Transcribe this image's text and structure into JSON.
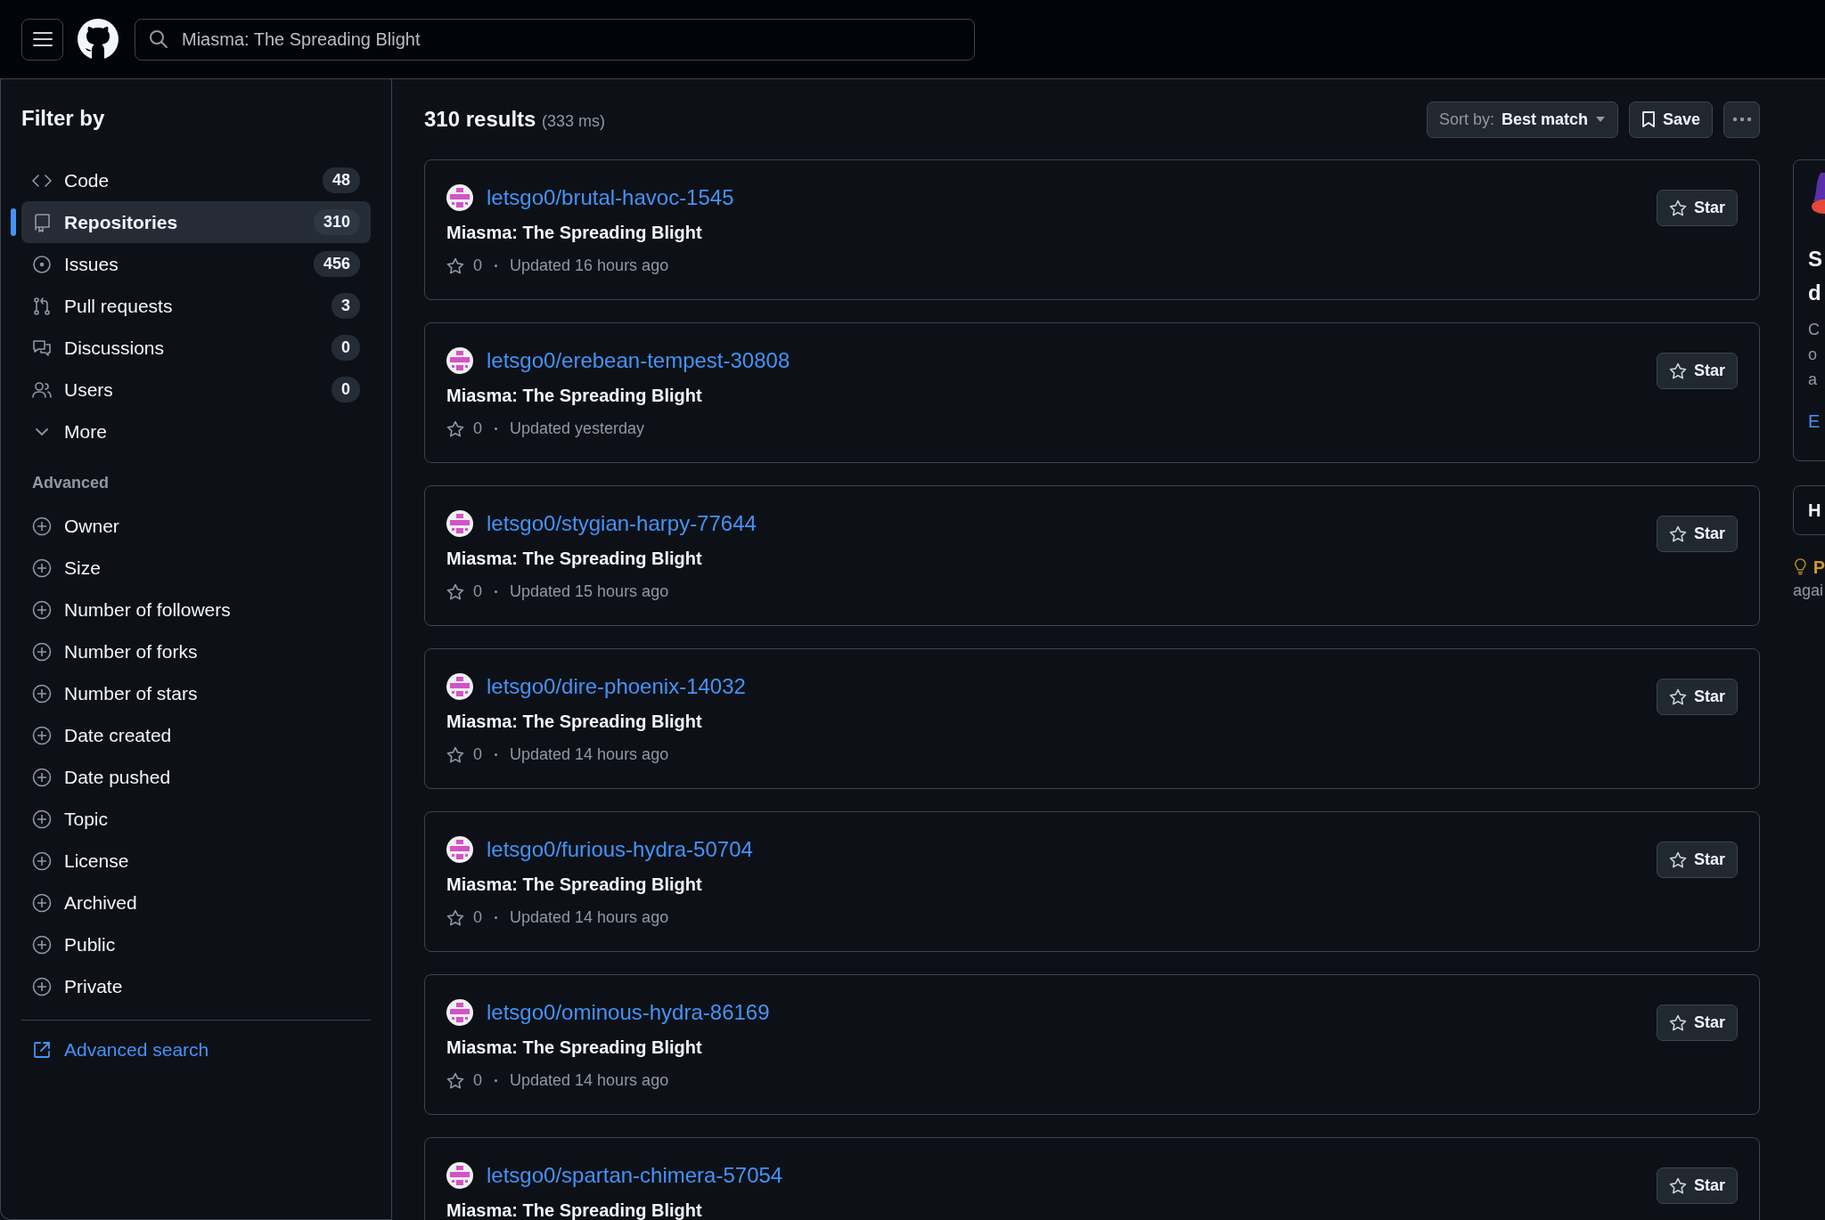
{
  "header": {
    "search_value": "Miasma: The Spreading Blight"
  },
  "sidebar": {
    "title": "Filter by",
    "items": [
      {
        "kind": "code",
        "label": "Code",
        "count": "48",
        "selected": false
      },
      {
        "kind": "repo",
        "label": "Repositories",
        "count": "310",
        "selected": true
      },
      {
        "kind": "issue",
        "label": "Issues",
        "count": "456",
        "selected": false
      },
      {
        "kind": "pull",
        "label": "Pull requests",
        "count": "3",
        "selected": false
      },
      {
        "kind": "discussion",
        "label": "Discussions",
        "count": "0",
        "selected": false
      },
      {
        "kind": "users",
        "label": "Users",
        "count": "0",
        "selected": false
      }
    ],
    "more": "More",
    "advanced_title": "Advanced",
    "advanced": [
      "Owner",
      "Size",
      "Number of followers",
      "Number of forks",
      "Number of stars",
      "Date created",
      "Date pushed",
      "Topic",
      "License",
      "Archived",
      "Public",
      "Private"
    ],
    "advanced_search": "Advanced search"
  },
  "results": {
    "count": "310 results",
    "timing": "(333 ms)",
    "sort_label": "Sort by:",
    "sort_value": "Best match",
    "save": "Save"
  },
  "repos": [
    {
      "name": "letsgo0/brutal-havoc-1545",
      "description": "Miasma: The Spreading Blight",
      "star_count": "0",
      "updated": "Updated 16 hours ago",
      "star_button": "Star"
    },
    {
      "name": "letsgo0/erebean-tempest-30808",
      "description": "Miasma: The Spreading Blight",
      "star_count": "0",
      "updated": "Updated yesterday",
      "star_button": "Star"
    },
    {
      "name": "letsgo0/stygian-harpy-77644",
      "description": "Miasma: The Spreading Blight",
      "star_count": "0",
      "updated": "Updated 15 hours ago",
      "star_button": "Star"
    },
    {
      "name": "letsgo0/dire-phoenix-14032",
      "description": "Miasma: The Spreading Blight",
      "star_count": "0",
      "updated": "Updated 14 hours ago",
      "star_button": "Star"
    },
    {
      "name": "letsgo0/furious-hydra-50704",
      "description": "Miasma: The Spreading Blight",
      "star_count": "0",
      "updated": "Updated 14 hours ago",
      "star_button": "Star"
    },
    {
      "name": "letsgo0/ominous-hydra-86169",
      "description": "Miasma: The Spreading Blight",
      "star_count": "0",
      "updated": "Updated 14 hours ago",
      "star_button": "Star"
    },
    {
      "name": "letsgo0/spartan-chimera-57054",
      "description": "Miasma: The Spreading Blight",
      "star_button": "Star"
    }
  ],
  "right_panel": {
    "title_lines": [
      "S",
      "d"
    ],
    "body_lines": [
      "C",
      "o",
      "a"
    ],
    "link": "E",
    "second_card": "H",
    "tip_title": "P",
    "tip_text": "agai"
  }
}
